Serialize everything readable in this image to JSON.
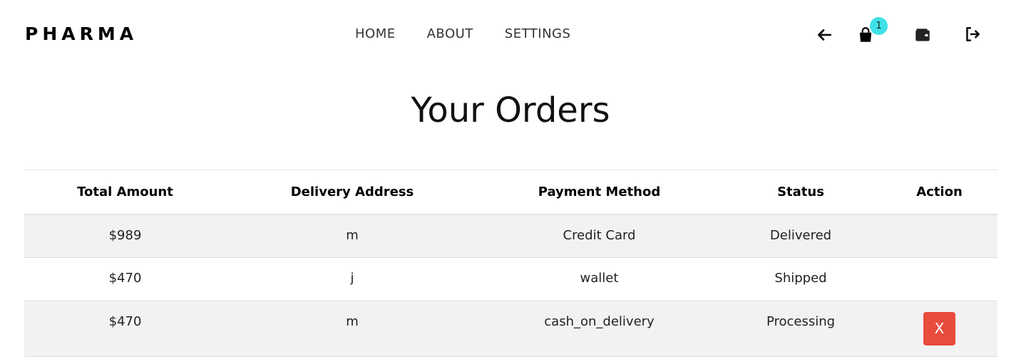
{
  "brand": "PHARMA",
  "nav": {
    "home": "HOME",
    "about": "ABOUT",
    "settings": "SETTINGS",
    "cart_count": "1"
  },
  "icons": [
    "arrow-left-icon",
    "shopping-bag-icon",
    "wallet-icon",
    "sign-out-icon"
  ],
  "title": "Your Orders",
  "table": {
    "headers": [
      "Total Amount",
      "Delivery Address",
      "Payment Method",
      "Status",
      "Action"
    ],
    "rows": [
      {
        "amount": "$989",
        "address": "m",
        "payment": "Credit Card",
        "status": "Delivered",
        "action": ""
      },
      {
        "amount": "$470",
        "address": "j",
        "payment": "wallet",
        "status": "Shipped",
        "action": ""
      },
      {
        "amount": "$470",
        "address": "m",
        "payment": "cash_on_delivery",
        "status": "Processing",
        "action": "X"
      }
    ]
  },
  "colors": {
    "cancel_button": "#e74c3c",
    "cart_badge": "#3fe0e6",
    "row_shade": "#f2f2f2"
  }
}
